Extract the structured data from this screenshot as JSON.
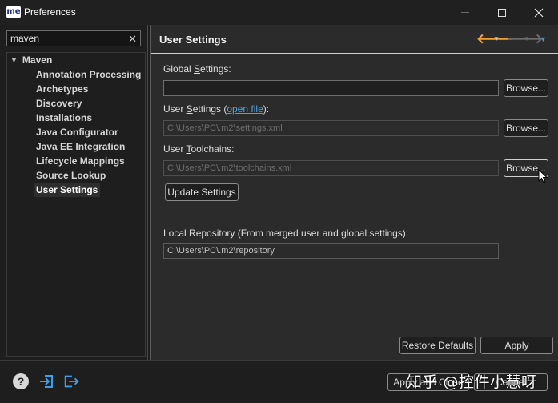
{
  "window": {
    "app_badge": "me",
    "title": "Preferences"
  },
  "sidebar": {
    "filter_value": "maven",
    "filter_clear": "✕",
    "root": "Maven",
    "items": [
      {
        "label": "Annotation Processing"
      },
      {
        "label": "Archetypes"
      },
      {
        "label": "Discovery"
      },
      {
        "label": "Installations"
      },
      {
        "label": "Java Configurator"
      },
      {
        "label": "Java EE Integration"
      },
      {
        "label": "Lifecycle Mappings"
      },
      {
        "label": "Source Lookup"
      },
      {
        "label": "User Settings"
      }
    ],
    "selected": "User Settings"
  },
  "page": {
    "title": "User Settings",
    "global_settings": {
      "label_pre": "Global ",
      "label_mnemonic": "S",
      "label_post": "ettings:",
      "value": "",
      "browse": "Browse..."
    },
    "user_settings": {
      "label_pre": "User ",
      "label_mnemonic": "S",
      "label_post": "ettings (",
      "link": "open file",
      "label_end": "):",
      "value": "C:\\Users\\PC\\.m2\\settings.xml",
      "browse": "Browse..."
    },
    "user_toolchains": {
      "label_pre": "User ",
      "label_mnemonic": "T",
      "label_post": "oolchains:",
      "value": "C:\\Users\\PC\\.m2\\toolchains.xml",
      "browse": "Browse..."
    },
    "update_button": "Update Settings",
    "local_repo": {
      "label": "Local Repository (From merged user and global settings):",
      "value": "C:\\Users\\PC\\.m2\\repository"
    },
    "restore_defaults": "Restore Defaults",
    "apply": "Apply"
  },
  "footer": {
    "help_icon": "?",
    "apply_close": "Apply and Close",
    "cancel": "Cancel",
    "watermark": "知乎 @控件小慧呀"
  },
  "colors": {
    "accent_back_arrow": "#f0a030",
    "link": "#4da3e0",
    "icon_blue": "#3aa0e8"
  }
}
